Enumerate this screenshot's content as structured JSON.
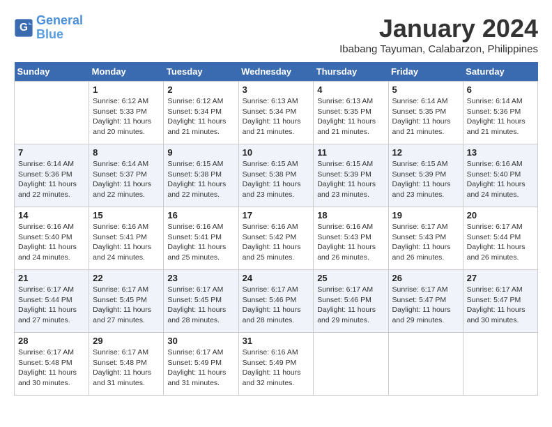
{
  "header": {
    "logo_line1": "General",
    "logo_line2": "Blue",
    "month": "January 2024",
    "location": "Ibabang Tayuman, Calabarzon, Philippines"
  },
  "weekdays": [
    "Sunday",
    "Monday",
    "Tuesday",
    "Wednesday",
    "Thursday",
    "Friday",
    "Saturday"
  ],
  "weeks": [
    [
      {
        "num": "",
        "sunrise": "",
        "sunset": "",
        "daylight": ""
      },
      {
        "num": "1",
        "sunrise": "Sunrise: 6:12 AM",
        "sunset": "Sunset: 5:33 PM",
        "daylight": "Daylight: 11 hours and 20 minutes."
      },
      {
        "num": "2",
        "sunrise": "Sunrise: 6:12 AM",
        "sunset": "Sunset: 5:34 PM",
        "daylight": "Daylight: 11 hours and 21 minutes."
      },
      {
        "num": "3",
        "sunrise": "Sunrise: 6:13 AM",
        "sunset": "Sunset: 5:34 PM",
        "daylight": "Daylight: 11 hours and 21 minutes."
      },
      {
        "num": "4",
        "sunrise": "Sunrise: 6:13 AM",
        "sunset": "Sunset: 5:35 PM",
        "daylight": "Daylight: 11 hours and 21 minutes."
      },
      {
        "num": "5",
        "sunrise": "Sunrise: 6:14 AM",
        "sunset": "Sunset: 5:35 PM",
        "daylight": "Daylight: 11 hours and 21 minutes."
      },
      {
        "num": "6",
        "sunrise": "Sunrise: 6:14 AM",
        "sunset": "Sunset: 5:36 PM",
        "daylight": "Daylight: 11 hours and 21 minutes."
      }
    ],
    [
      {
        "num": "7",
        "sunrise": "Sunrise: 6:14 AM",
        "sunset": "Sunset: 5:36 PM",
        "daylight": "Daylight: 11 hours and 22 minutes."
      },
      {
        "num": "8",
        "sunrise": "Sunrise: 6:14 AM",
        "sunset": "Sunset: 5:37 PM",
        "daylight": "Daylight: 11 hours and 22 minutes."
      },
      {
        "num": "9",
        "sunrise": "Sunrise: 6:15 AM",
        "sunset": "Sunset: 5:38 PM",
        "daylight": "Daylight: 11 hours and 22 minutes."
      },
      {
        "num": "10",
        "sunrise": "Sunrise: 6:15 AM",
        "sunset": "Sunset: 5:38 PM",
        "daylight": "Daylight: 11 hours and 23 minutes."
      },
      {
        "num": "11",
        "sunrise": "Sunrise: 6:15 AM",
        "sunset": "Sunset: 5:39 PM",
        "daylight": "Daylight: 11 hours and 23 minutes."
      },
      {
        "num": "12",
        "sunrise": "Sunrise: 6:15 AM",
        "sunset": "Sunset: 5:39 PM",
        "daylight": "Daylight: 11 hours and 23 minutes."
      },
      {
        "num": "13",
        "sunrise": "Sunrise: 6:16 AM",
        "sunset": "Sunset: 5:40 PM",
        "daylight": "Daylight: 11 hours and 24 minutes."
      }
    ],
    [
      {
        "num": "14",
        "sunrise": "Sunrise: 6:16 AM",
        "sunset": "Sunset: 5:40 PM",
        "daylight": "Daylight: 11 hours and 24 minutes."
      },
      {
        "num": "15",
        "sunrise": "Sunrise: 6:16 AM",
        "sunset": "Sunset: 5:41 PM",
        "daylight": "Daylight: 11 hours and 24 minutes."
      },
      {
        "num": "16",
        "sunrise": "Sunrise: 6:16 AM",
        "sunset": "Sunset: 5:41 PM",
        "daylight": "Daylight: 11 hours and 25 minutes."
      },
      {
        "num": "17",
        "sunrise": "Sunrise: 6:16 AM",
        "sunset": "Sunset: 5:42 PM",
        "daylight": "Daylight: 11 hours and 25 minutes."
      },
      {
        "num": "18",
        "sunrise": "Sunrise: 6:16 AM",
        "sunset": "Sunset: 5:43 PM",
        "daylight": "Daylight: 11 hours and 26 minutes."
      },
      {
        "num": "19",
        "sunrise": "Sunrise: 6:17 AM",
        "sunset": "Sunset: 5:43 PM",
        "daylight": "Daylight: 11 hours and 26 minutes."
      },
      {
        "num": "20",
        "sunrise": "Sunrise: 6:17 AM",
        "sunset": "Sunset: 5:44 PM",
        "daylight": "Daylight: 11 hours and 26 minutes."
      }
    ],
    [
      {
        "num": "21",
        "sunrise": "Sunrise: 6:17 AM",
        "sunset": "Sunset: 5:44 PM",
        "daylight": "Daylight: 11 hours and 27 minutes."
      },
      {
        "num": "22",
        "sunrise": "Sunrise: 6:17 AM",
        "sunset": "Sunset: 5:45 PM",
        "daylight": "Daylight: 11 hours and 27 minutes."
      },
      {
        "num": "23",
        "sunrise": "Sunrise: 6:17 AM",
        "sunset": "Sunset: 5:45 PM",
        "daylight": "Daylight: 11 hours and 28 minutes."
      },
      {
        "num": "24",
        "sunrise": "Sunrise: 6:17 AM",
        "sunset": "Sunset: 5:46 PM",
        "daylight": "Daylight: 11 hours and 28 minutes."
      },
      {
        "num": "25",
        "sunrise": "Sunrise: 6:17 AM",
        "sunset": "Sunset: 5:46 PM",
        "daylight": "Daylight: 11 hours and 29 minutes."
      },
      {
        "num": "26",
        "sunrise": "Sunrise: 6:17 AM",
        "sunset": "Sunset: 5:47 PM",
        "daylight": "Daylight: 11 hours and 29 minutes."
      },
      {
        "num": "27",
        "sunrise": "Sunrise: 6:17 AM",
        "sunset": "Sunset: 5:47 PM",
        "daylight": "Daylight: 11 hours and 30 minutes."
      }
    ],
    [
      {
        "num": "28",
        "sunrise": "Sunrise: 6:17 AM",
        "sunset": "Sunset: 5:48 PM",
        "daylight": "Daylight: 11 hours and 30 minutes."
      },
      {
        "num": "29",
        "sunrise": "Sunrise: 6:17 AM",
        "sunset": "Sunset: 5:48 PM",
        "daylight": "Daylight: 11 hours and 31 minutes."
      },
      {
        "num": "30",
        "sunrise": "Sunrise: 6:17 AM",
        "sunset": "Sunset: 5:49 PM",
        "daylight": "Daylight: 11 hours and 31 minutes."
      },
      {
        "num": "31",
        "sunrise": "Sunrise: 6:16 AM",
        "sunset": "Sunset: 5:49 PM",
        "daylight": "Daylight: 11 hours and 32 minutes."
      },
      {
        "num": "",
        "sunrise": "",
        "sunset": "",
        "daylight": ""
      },
      {
        "num": "",
        "sunrise": "",
        "sunset": "",
        "daylight": ""
      },
      {
        "num": "",
        "sunrise": "",
        "sunset": "",
        "daylight": ""
      }
    ]
  ]
}
